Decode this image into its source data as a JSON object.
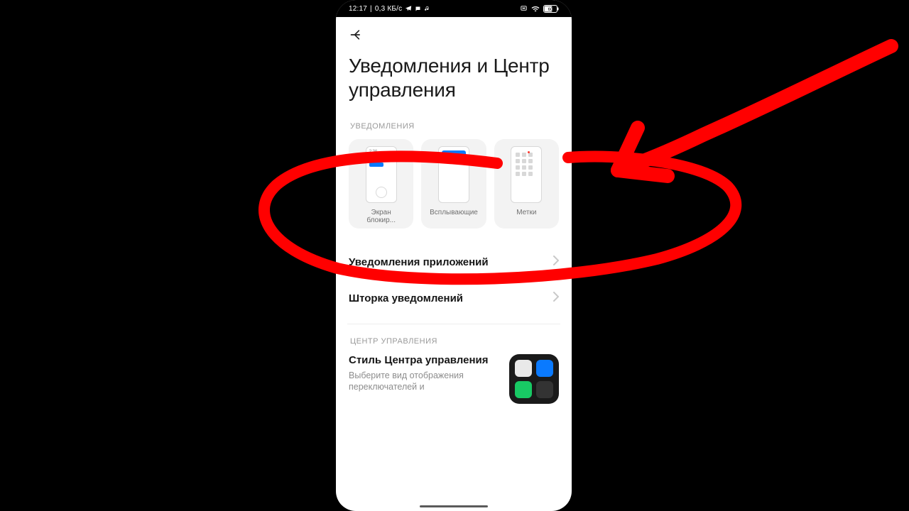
{
  "status": {
    "time": "12:17",
    "net_speed": "0,3 КБ/с",
    "battery": "60"
  },
  "header": {
    "title": "Уведомления и Центр управления"
  },
  "notifications": {
    "section_label": "УВЕДОМЛЕНИЯ",
    "tiles": {
      "lockscreen": {
        "label": "Экран\nблокир...",
        "preview_time": "2:36"
      },
      "floating": {
        "label": "Всплывающие"
      },
      "badges": {
        "label": "Метки"
      }
    },
    "items": {
      "app_notifications": "Уведомления приложений",
      "notification_shade": "Шторка уведомлений"
    }
  },
  "control_center": {
    "section_label": "ЦЕНТР УПРАВЛЕНИЯ",
    "style_title": "Стиль Центра управления",
    "style_desc": "Выберите вид отображения переключателей и"
  }
}
